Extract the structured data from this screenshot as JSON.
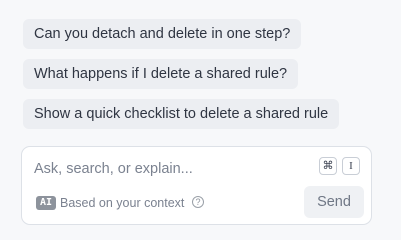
{
  "suggestions": [
    {
      "label": "Can you detach and delete in one step?"
    },
    {
      "label": "What happens if I delete a shared rule?"
    },
    {
      "label": "Show a quick checklist to delete a shared rule"
    }
  ],
  "composer": {
    "placeholder": "Ask, search, or explain...",
    "shortcut_keys": [
      "⌘",
      "I"
    ],
    "ai_badge": "AI",
    "context_label": "Based on your context",
    "help_glyph": "?",
    "send_label": "Send"
  }
}
